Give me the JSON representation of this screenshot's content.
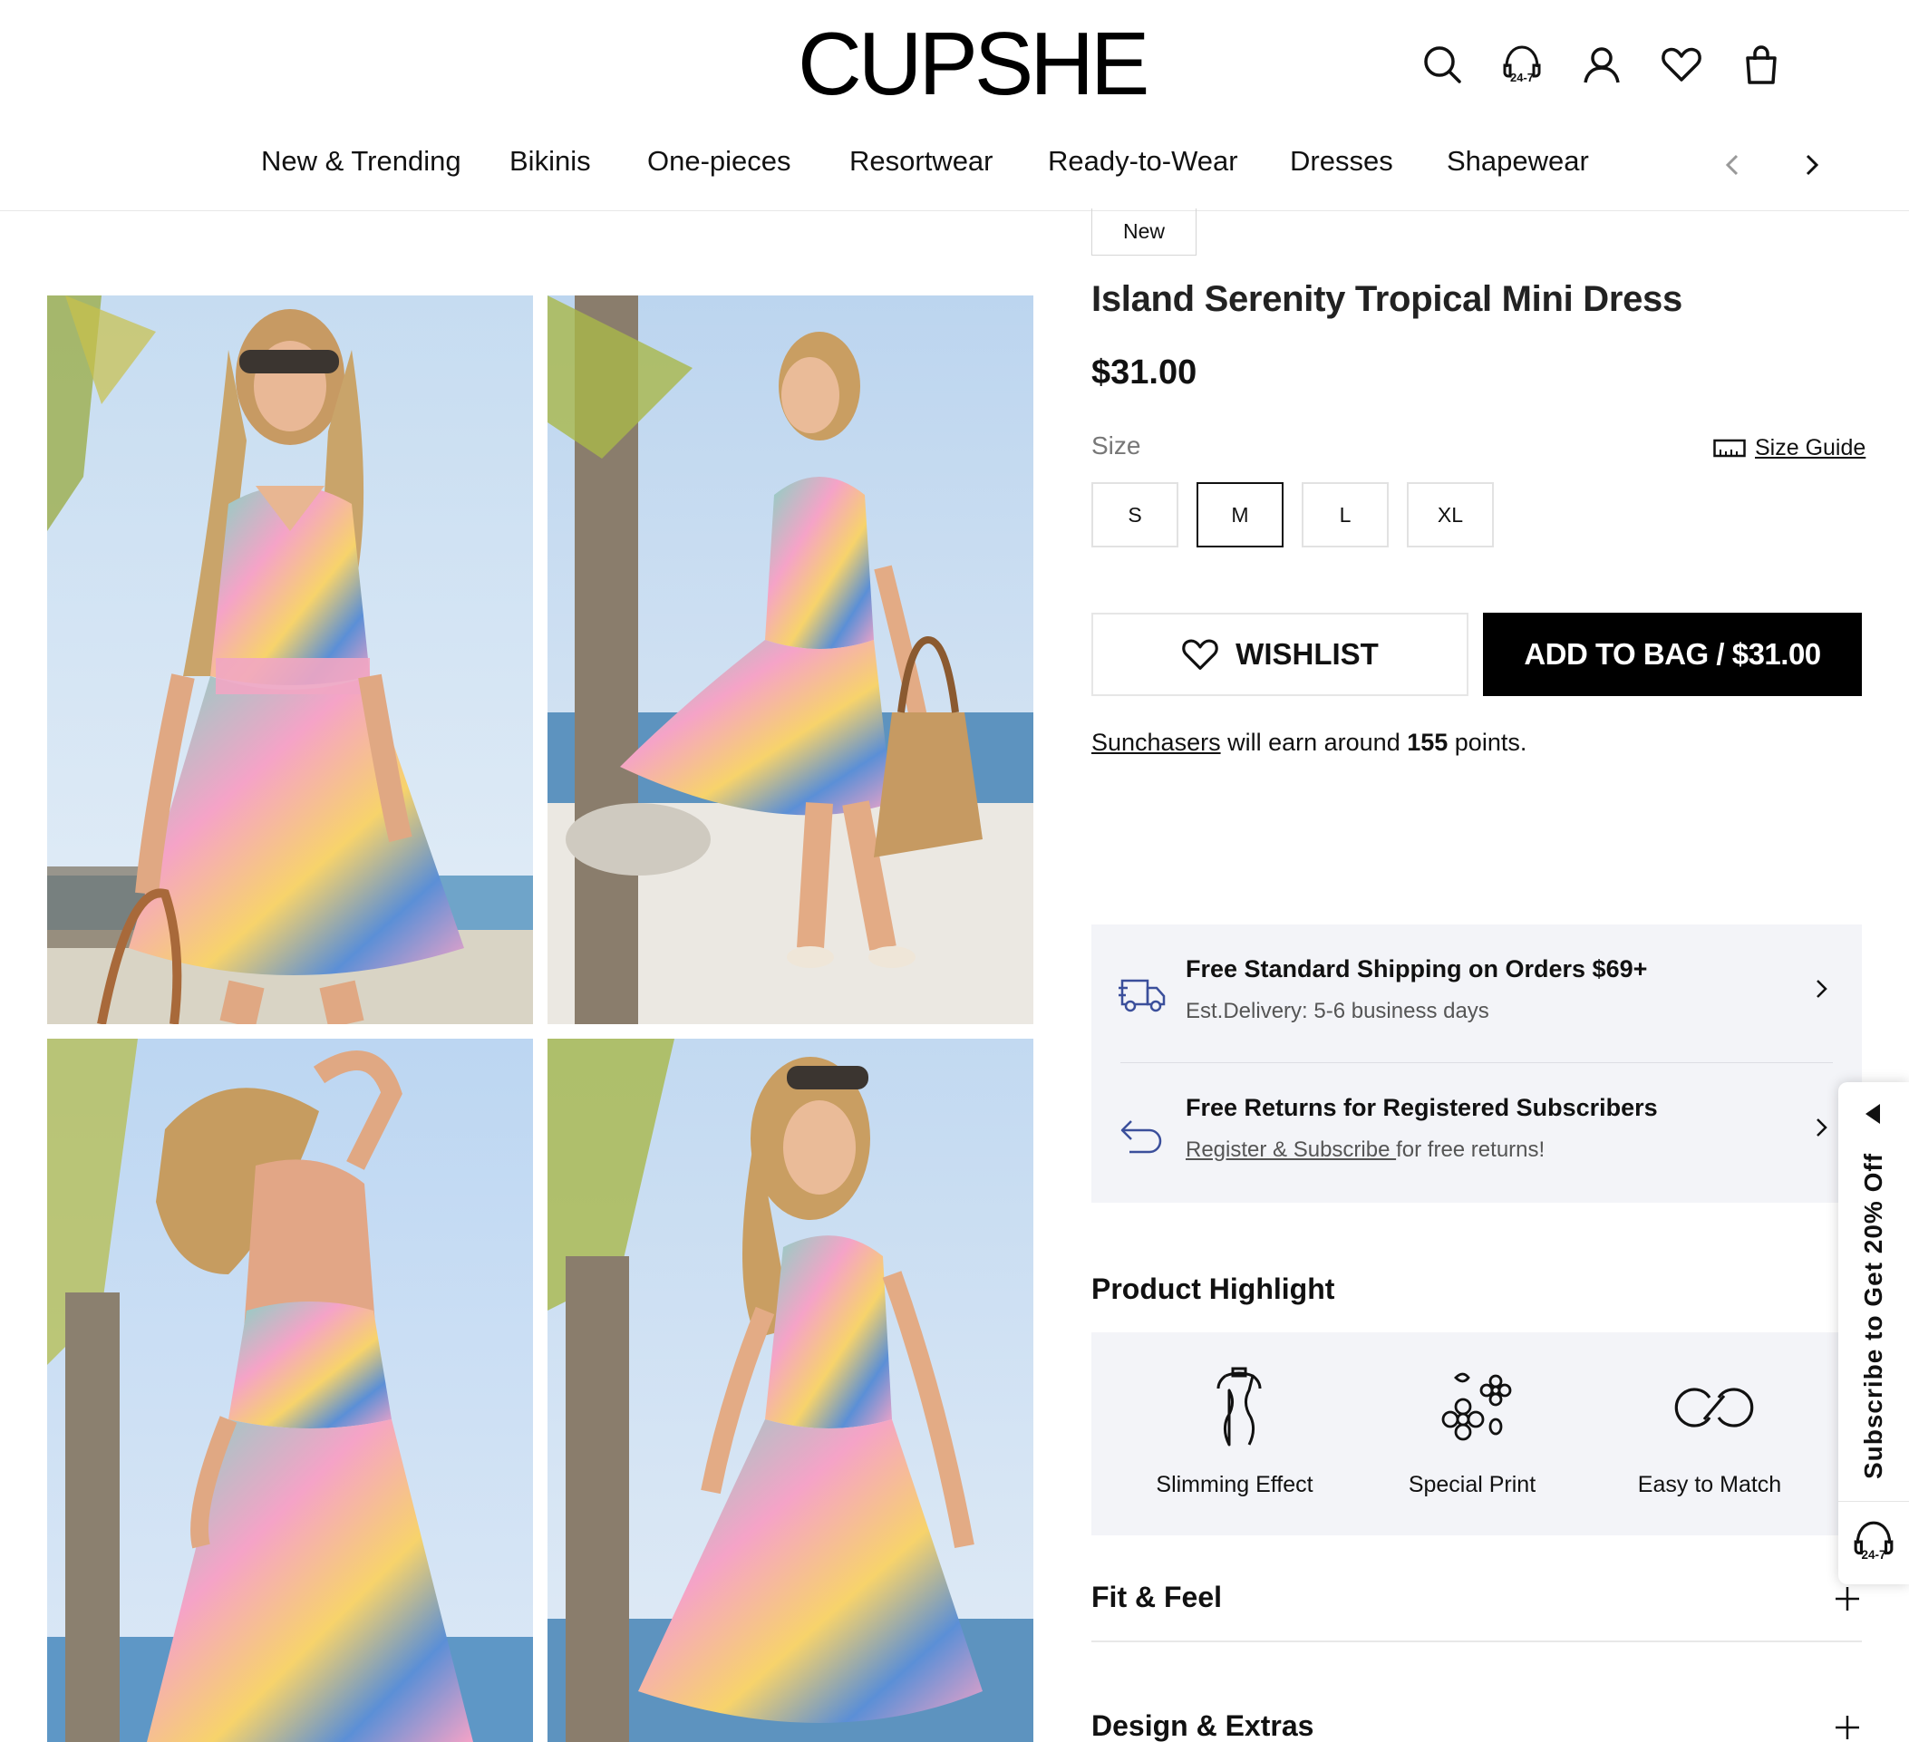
{
  "header": {
    "logo": "CUPSHE",
    "icons": [
      "search-icon",
      "customer-service-24-7-icon",
      "account-icon",
      "wishlist-heart-icon",
      "shopping-bag-icon"
    ],
    "chat_badge": "24-7"
  },
  "nav": {
    "items": [
      "New & Trending",
      "Bikinis",
      "One-pieces",
      "Resortwear",
      "Ready-to-Wear",
      "Dresses",
      "Shapewear"
    ]
  },
  "gallery": {
    "images": [
      "model-front-view-photo",
      "model-walking-with-tote-photo",
      "model-back-view-photo",
      "model-side-view-photo"
    ]
  },
  "product": {
    "badge": "New",
    "title": "Island Serenity Tropical Mini Dress",
    "price": "$31.00",
    "size_label": "Size",
    "size_guide": "Size Guide",
    "sizes": [
      "S",
      "M",
      "L",
      "XL"
    ],
    "selected_size": "M",
    "wishlist_label": "WISHLIST",
    "add_to_bag_label": "ADD TO BAG / $31.00",
    "points": {
      "link": "Sunchasers",
      "pre": " will earn around ",
      "value": "155",
      "post": " points."
    }
  },
  "shipping": {
    "standard_title": "Free Standard Shipping on Orders $69+",
    "standard_sub": "Est.Delivery: 5-6 business days",
    "returns_title": "Free Returns for Registered Subscribers",
    "returns_link": "Register & Subscribe ",
    "returns_sub": "for free returns!"
  },
  "highlight": {
    "title": "Product Highlight",
    "items": [
      {
        "label": "Slimming Effect",
        "icon": "dress-form-icon"
      },
      {
        "label": "Special Print",
        "icon": "flowers-icon"
      },
      {
        "label": "Easy to Match",
        "icon": "infinity-rings-icon"
      }
    ]
  },
  "accordions": [
    "Fit & Feel",
    "Design & Extras"
  ],
  "subscribe_tab": {
    "text": "Subscribe to Get 20% Off",
    "chat_badge": "24-7"
  },
  "colors": {
    "accent": "#000000",
    "panel_bg": "#f3f4f8",
    "icon_blue": "#3b4f9b"
  }
}
